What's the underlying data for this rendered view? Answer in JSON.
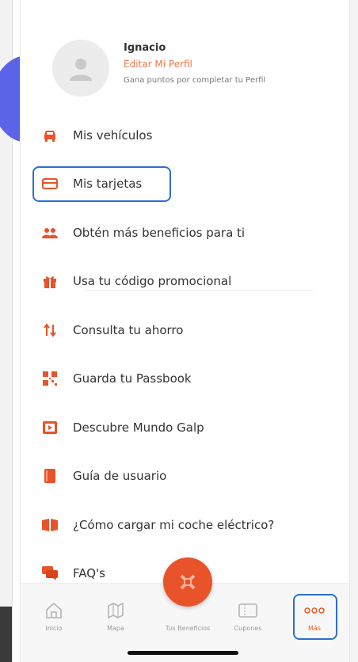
{
  "profile": {
    "name": "Ignacio",
    "edit_label": "Editar Mi Perfil",
    "subtitle": "Gana puntos por completar tu Perfil"
  },
  "menu": {
    "items": [
      {
        "label": "Mis vehículos",
        "icon": "car-icon"
      },
      {
        "label": "Mis tarjetas",
        "icon": "credit-card-icon"
      },
      {
        "label": "Obtén más beneficios para ti",
        "icon": "people-icon"
      },
      {
        "label": "Usa tu código promocional",
        "icon": "gift-icon"
      },
      {
        "label": "Consulta tu ahorro",
        "icon": "arrows-updown-icon"
      },
      {
        "label": "Guarda tu Passbook",
        "icon": "qr-code-icon"
      },
      {
        "label": "Descubre Mundo Galp",
        "icon": "video-icon"
      },
      {
        "label": "Guía de usuario",
        "icon": "book-icon"
      },
      {
        "label": "¿Cómo cargar mi coche eléctrico?",
        "icon": "book-open-icon"
      },
      {
        "label": "FAQ's",
        "icon": "chat-icon"
      }
    ]
  },
  "bottom_nav": {
    "items": [
      {
        "label": "Inicio",
        "icon": "home-icon"
      },
      {
        "label": "Mapa",
        "icon": "map-icon"
      },
      {
        "label": "Tus Beneficios",
        "icon": "benefits-icon"
      },
      {
        "label": "Cupones",
        "icon": "coupon-icon"
      },
      {
        "label": "Más",
        "icon": "more-dots-icon"
      }
    ]
  },
  "colors": {
    "accent": "#e8532a",
    "highlight": "#2d6fd0",
    "text": "#333333"
  }
}
